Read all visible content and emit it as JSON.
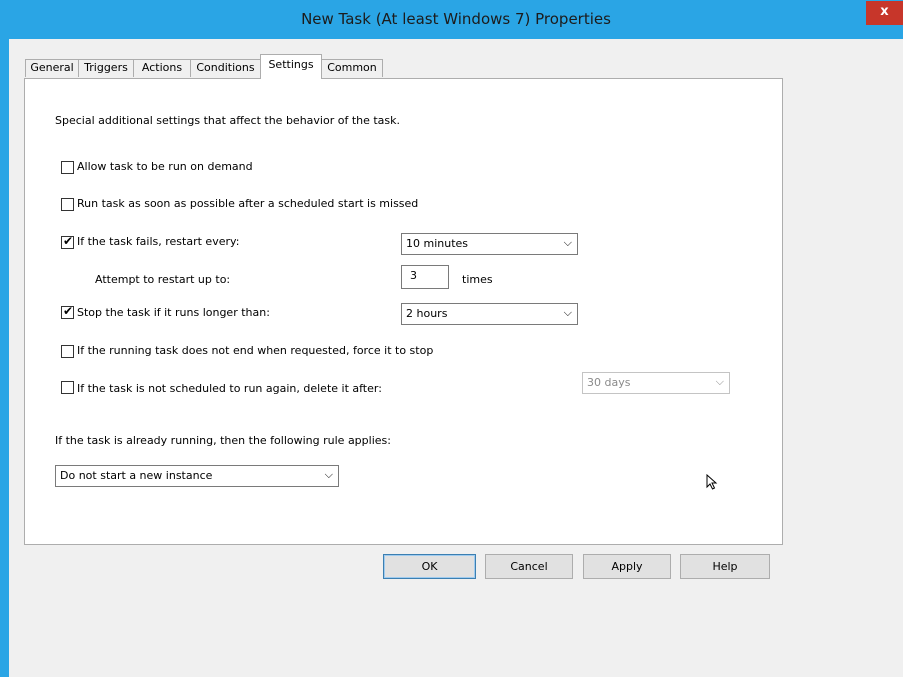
{
  "window": {
    "title": "New Task (At least Windows 7) Properties",
    "close_glyph": "x",
    "accent_color": "#2aa5e5",
    "close_color": "#c7362a"
  },
  "tabs": [
    {
      "label": "General",
      "active": false
    },
    {
      "label": "Triggers",
      "active": false
    },
    {
      "label": "Actions",
      "active": false
    },
    {
      "label": "Conditions",
      "active": false
    },
    {
      "label": "Settings",
      "active": true
    },
    {
      "label": "Common",
      "active": false
    }
  ],
  "settings": {
    "description": "Special additional settings that affect the behavior of the task.",
    "allow_on_demand": {
      "label": "Allow task to be run on demand",
      "checked": false
    },
    "run_missed": {
      "label": "Run task as soon as possible after a scheduled start is missed",
      "checked": false
    },
    "restart_on_fail": {
      "label": "If the task fails, restart every:",
      "checked": true,
      "value": "10 minutes"
    },
    "restart_attempts": {
      "label": "Attempt to restart up to:",
      "value": "3",
      "unit": "times"
    },
    "stop_long": {
      "label": "Stop the task if it runs longer than:",
      "checked": true,
      "value": "2 hours"
    },
    "force_stop": {
      "label": "If the running task does not end when requested, force it to stop",
      "checked": false
    },
    "delete_after": {
      "label": "If the task is not scheduled to run again, delete it after:",
      "checked": false,
      "value": "30 days"
    },
    "running_rule_label": "If the task is already running, then the following rule applies:",
    "running_rule_value": "Do not start a new instance"
  },
  "buttons": {
    "ok": "OK",
    "cancel": "Cancel",
    "apply": "Apply",
    "help": "Help"
  },
  "icons": {
    "check": "✔",
    "chevron": "⌵"
  }
}
